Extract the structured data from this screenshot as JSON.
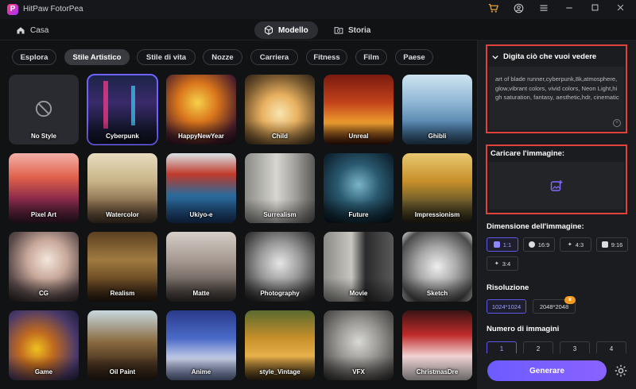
{
  "app": {
    "title": "HitPaw FotorPea",
    "logo_letter": "P"
  },
  "nav": {
    "home": "Casa",
    "tabs": [
      {
        "label": "Modello",
        "active": true
      },
      {
        "label": "Storia",
        "active": false
      }
    ]
  },
  "categories": [
    {
      "label": "Esplora",
      "active": false
    },
    {
      "label": "Stile Artistico",
      "active": true
    },
    {
      "label": "Stile di vita",
      "active": false
    },
    {
      "label": "Nozze",
      "active": false
    },
    {
      "label": "Carriera",
      "active": false
    },
    {
      "label": "Fitness",
      "active": false
    },
    {
      "label": "Film",
      "active": false
    },
    {
      "label": "Paese",
      "active": false
    }
  ],
  "styles": [
    "No Style",
    "Cyberpunk",
    "HappyNewYear",
    "Child",
    "Unreal",
    "Ghibli",
    "Pixel Art",
    "Watercolor",
    "Ukiyo-e",
    "Surrealism",
    "Future",
    "Impressionism",
    "CG",
    "Realism",
    "Matte",
    "Photography",
    "Movie",
    "Sketch",
    "Game",
    "Oil Paint",
    "Anime",
    "style_Vintage",
    "VFX",
    "ChristmasDre"
  ],
  "selected_style": "Cyberpunk",
  "prompt": {
    "heading": "Digita ciò che vuoi vedere",
    "text": "art of blade runner,cyberpunk,8k,atmosphere, glow,vibrant colors, vivid colors, Neon Light,high saturation, fantasy, aesthetic,hdr, cinematic"
  },
  "upload": {
    "label": "Caricare l'immagine:"
  },
  "size": {
    "label": "Dimensione dell'immagine:",
    "options": [
      {
        "label": "1:1",
        "active": true
      },
      {
        "label": "16:9",
        "active": false
      },
      {
        "label": "4:3",
        "active": false
      },
      {
        "label": "9:16",
        "active": false
      },
      {
        "label": "3:4",
        "active": false
      }
    ]
  },
  "resolution": {
    "label": "Risoluzione",
    "options": [
      {
        "label": "1024*1024",
        "active": true
      },
      {
        "label": "2048*2048",
        "active": false
      }
    ]
  },
  "count": {
    "label": "Numero di immagini",
    "options": [
      {
        "label": "1",
        "active": true
      },
      {
        "label": "2",
        "active": false
      },
      {
        "label": "3",
        "active": false
      },
      {
        "label": "4",
        "active": false
      }
    ]
  },
  "generate_label": "Generare",
  "colors": {
    "accent": "#6c5cff",
    "highlight": "#e0413a",
    "background": "#111214",
    "panel": "#1b1c20"
  }
}
